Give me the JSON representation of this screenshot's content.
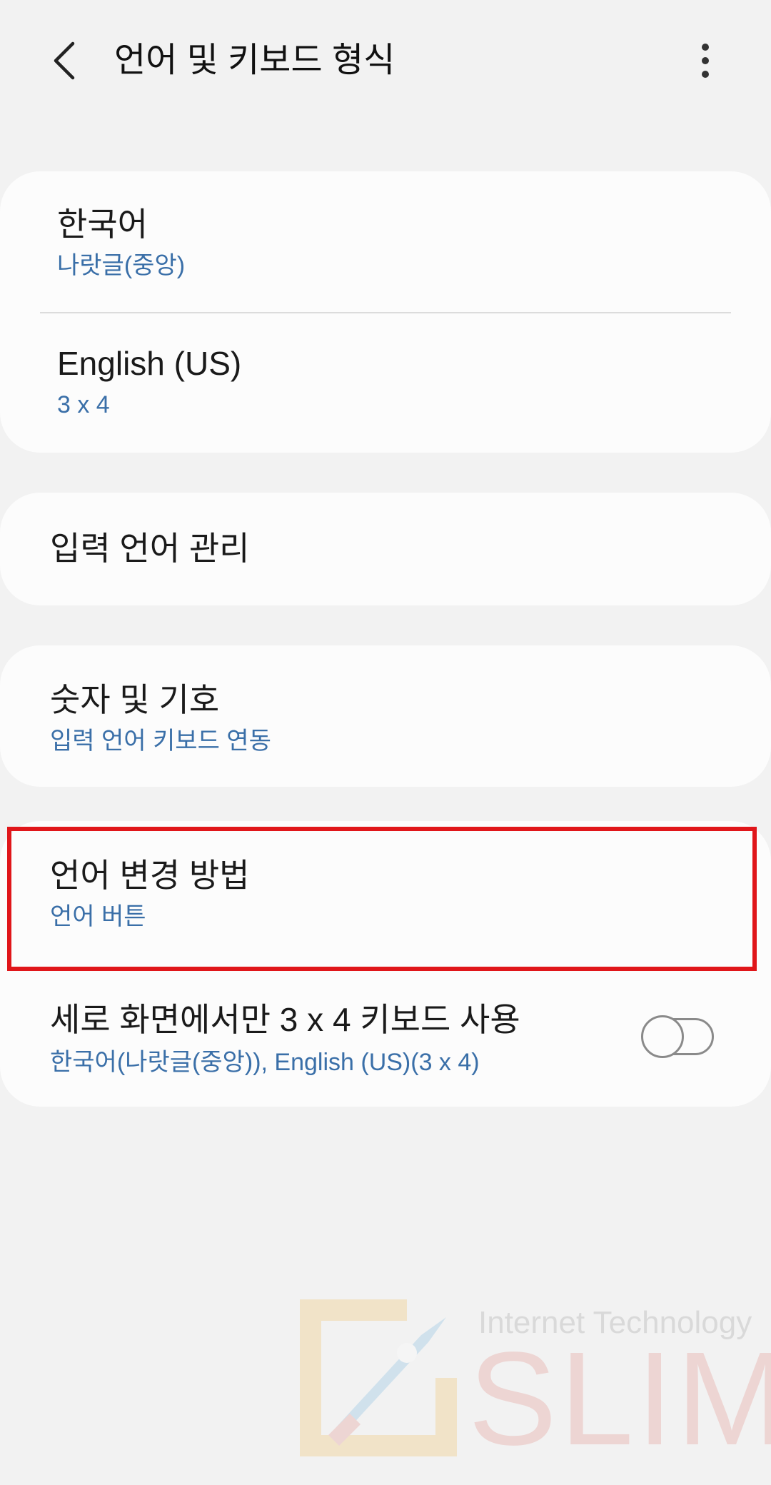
{
  "header": {
    "back_icon": "chevron-left-icon",
    "title": "언어 및 키보드 형식",
    "more_icon": "more-vert-icon"
  },
  "languages": [
    {
      "title": "한국어",
      "subtitle": "나랏글(중앙)"
    },
    {
      "title": "English (US)",
      "subtitle": "3 x 4"
    }
  ],
  "manage": {
    "title": "입력 언어 관리"
  },
  "numbers": {
    "title": "숫자 및 기호",
    "subtitle": "입력 언어 키보드 연동"
  },
  "switch_method": {
    "title": "언어 변경 방법",
    "subtitle": "언어 버튼"
  },
  "portrait_only": {
    "title": "세로 화면에서만 3 x 4 키보드 사용",
    "subtitle": "한국어(나랏글(중앙)), English (US)(3 x 4)",
    "toggle_on": false
  },
  "watermark": {
    "tagline": "Internet Technology",
    "brand": "SLIM"
  },
  "colors": {
    "background": "#f2f2f2",
    "card": "#fcfcfc",
    "accent_text": "#3a6fa8",
    "highlight": "#e0161a"
  }
}
